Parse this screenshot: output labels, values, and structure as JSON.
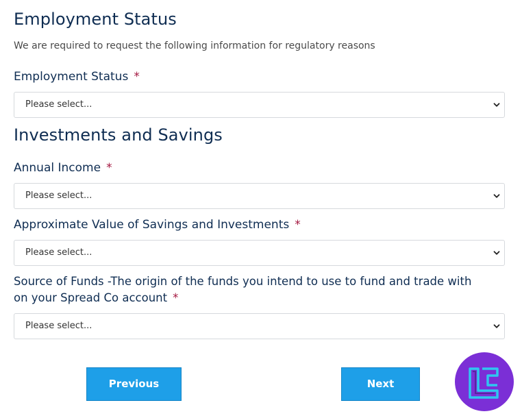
{
  "employment": {
    "heading": "Employment Status",
    "intro": "We are required to request the following information for regulatory reasons",
    "status_label": "Employment Status",
    "required_mark": "*",
    "status_value": "Please select..."
  },
  "investments": {
    "heading": "Investments and Savings",
    "income_label": "Annual Income",
    "income_value": "Please select...",
    "savings_label": "Approximate Value of Savings and Investments",
    "savings_value": "Please select...",
    "funds_label_line1": "Source of Funds -The origin of the funds you intend to use to fund and trade with",
    "funds_label_line2": "on your Spread Co account",
    "funds_value": "Please select..."
  },
  "buttons": {
    "previous": "Previous",
    "next": "Next"
  },
  "colors": {
    "heading": "#0f2d52",
    "required": "#a3163f",
    "button": "#1e9fe8",
    "logo_bg": "#7b2fd6",
    "logo_mark": "#2fc6f0"
  },
  "icons": {
    "select_arrow": "chevron-down-icon",
    "logo": "tradingfinder-logo"
  }
}
